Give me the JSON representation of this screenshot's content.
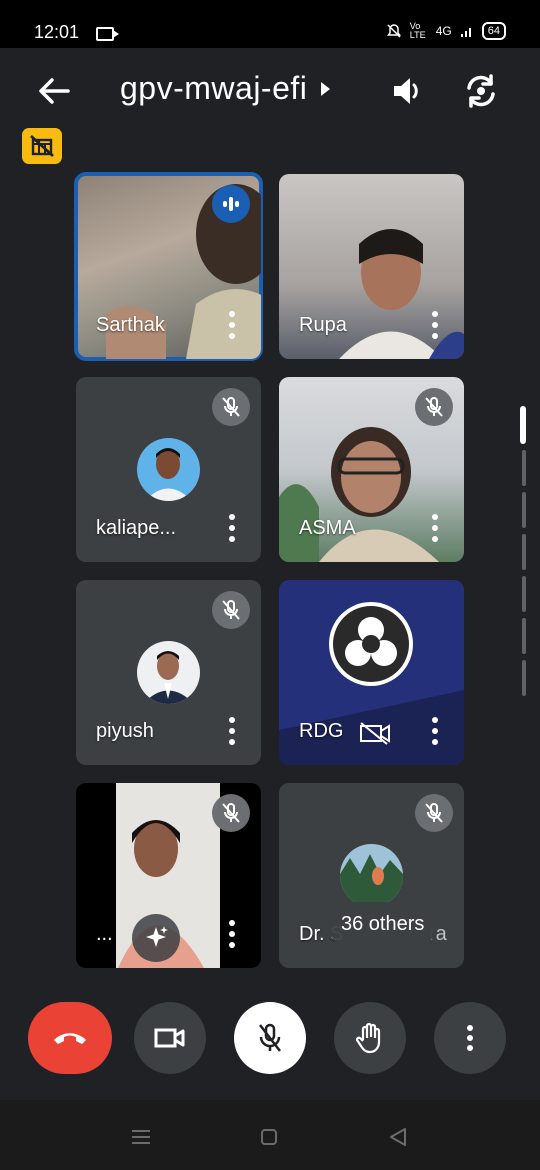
{
  "status": {
    "time": "12:01",
    "battery": "64",
    "volte": "Vo LTE",
    "network": "4G"
  },
  "meeting": {
    "code": "gpv-mwaj-efi"
  },
  "participants": [
    {
      "name": "Sarthak",
      "speaking": true
    },
    {
      "name": "Rupa"
    },
    {
      "name": "kaliape...",
      "muted": true
    },
    {
      "name": "ASMA",
      "muted": true
    },
    {
      "name": "piyush",
      "muted": true
    },
    {
      "name": "RDG",
      "camera_off": true
    },
    {
      "name": "...",
      "muted": true
    },
    {
      "name": "Dr. S",
      "muted": true,
      "overflow_label": "36 others",
      "trailing_text": "ra"
    }
  ],
  "colors": {
    "end_call": "#ea4335",
    "accent": "#1a5fb4",
    "badge": "#f9bb10"
  }
}
